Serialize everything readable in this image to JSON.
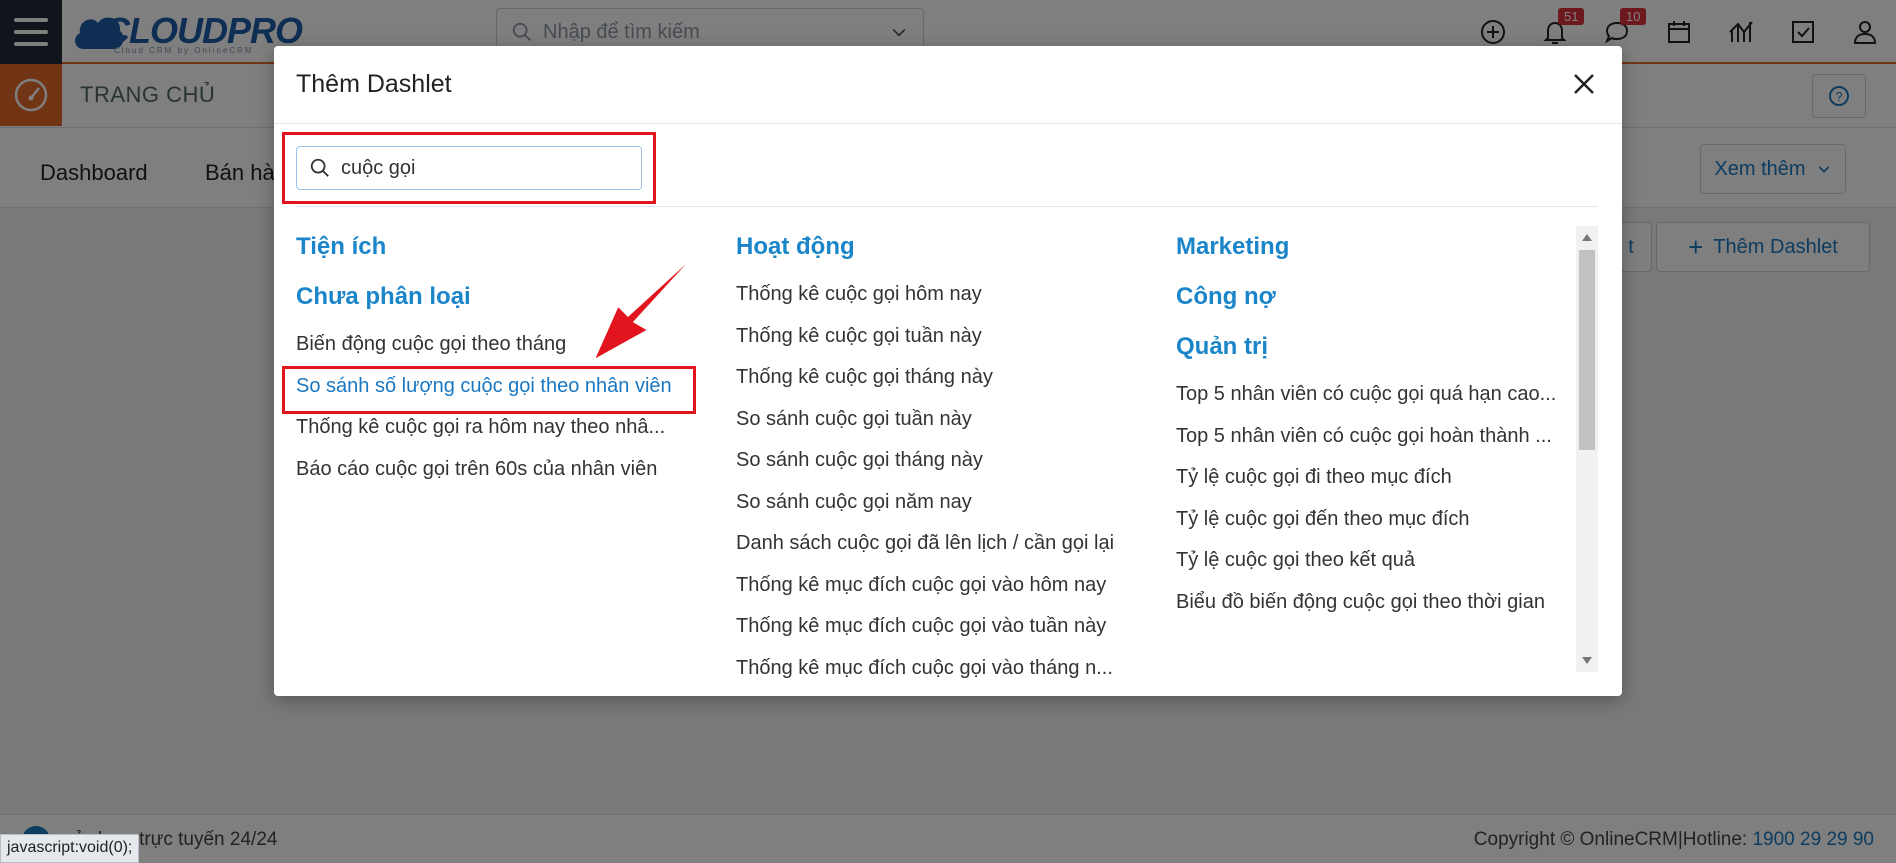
{
  "app": {
    "logo_text": "CLOUDPRO",
    "logo_sub": "Cloud CRM by OnlineCRM",
    "search_placeholder": "Nhập để tìm kiếm",
    "notifications_count": "51",
    "messages_count": "10",
    "page_title": "TRANG CHỦ",
    "tabs": [
      "Dashboard",
      "Bán hà"
    ],
    "more_label": "Xem thêm",
    "partial_btn_label": "t",
    "add_dashlet_label": "Thêm Dashlet",
    "footer_left": "sử dụng trực tuyến 24/24",
    "footer_right_prefix": "Copyright © OnlineCRM|Hotline: ",
    "hotline": "1900 29 29 90",
    "status_url": "javascript:void(0);",
    "colors": {
      "brand_blue": "#1c5da8",
      "brand_orange": "#e36a2a",
      "link_blue": "#1a85c8",
      "highlight_red": "#e2141d"
    }
  },
  "modal": {
    "title": "Thêm Dashlet",
    "search_value": "cuộc gọi",
    "columns": [
      {
        "groups": [
          {
            "category": "Tiện ích",
            "items": []
          },
          {
            "category": "Chưa phân loại",
            "items": [
              "Biến động cuộc gọi theo tháng",
              "So sánh số lượng cuộc gọi theo nhân viên",
              "Thống kê cuộc gọi ra hôm nay theo nhâ...",
              "Báo cáo cuộc gọi trên 60s của nhân viên"
            ]
          }
        ]
      },
      {
        "groups": [
          {
            "category": "Hoạt động",
            "items": [
              "Thống kê cuộc gọi hôm nay",
              "Thống kê cuộc gọi tuần này",
              "Thống kê cuộc gọi tháng này",
              "So sánh cuộc gọi tuần này",
              "So sánh cuộc gọi tháng này",
              "So sánh cuộc gọi năm nay",
              "Danh sách cuộc gọi đã lên lịch / cần gọi lại",
              "Thống kê mục đích cuộc gọi vào hôm nay",
              "Thống kê mục đích cuộc gọi vào tuần này",
              "Thống kê mục đích cuộc gọi vào tháng n..."
            ]
          }
        ]
      },
      {
        "groups": [
          {
            "category": "Marketing",
            "items": []
          },
          {
            "category": "Công nợ",
            "items": []
          },
          {
            "category": "Quản trị",
            "items": [
              "Top 5 nhân viên có cuộc gọi quá hạn cao...",
              "Top 5 nhân viên có cuộc gọi hoàn thành ...",
              "Tỷ lệ cuộc gọi đi theo mục đích",
              "Tỷ lệ cuộc gọi đến theo mục đích",
              "Tỷ lệ cuộc gọi theo kết quả",
              "Biểu đồ biến động cuộc gọi theo thời gian"
            ]
          }
        ]
      }
    ],
    "selected_item": "So sánh số lượng cuộc gọi theo nhân viên"
  }
}
